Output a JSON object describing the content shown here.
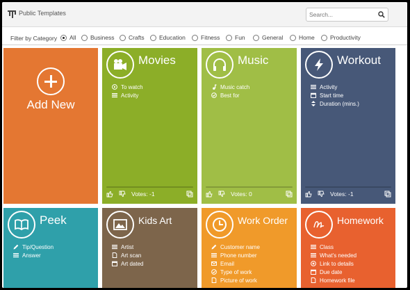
{
  "app": {
    "title": "Public Templates"
  },
  "search": {
    "placeholder": "Search..."
  },
  "filter": {
    "label": "Filter by Category",
    "options": [
      "All",
      "Business",
      "Crafts",
      "Education",
      "Fitness",
      "Fun",
      "General",
      "Home",
      "Productivity"
    ],
    "selected": "All"
  },
  "add_tile": {
    "label": "Add New",
    "color": "#e47732"
  },
  "tiles": [
    {
      "title": "Movies",
      "color": "#8cae28",
      "icon": "movie-camera-icon",
      "fields": [
        {
          "icon": "play-circle-icon",
          "label": "To watch"
        },
        {
          "icon": "list-icon",
          "label": "Activity"
        }
      ],
      "votes": "Votes: -1"
    },
    {
      "title": "Music",
      "color": "#a0be46",
      "icon": "headphones-icon",
      "fields": [
        {
          "icon": "music-note-icon",
          "label": "Music catch"
        },
        {
          "icon": "check-circle-icon",
          "label": "Best for"
        }
      ],
      "votes": "Votes: 0"
    },
    {
      "title": "Workout",
      "color": "#475878",
      "icon": "lightning-icon",
      "fields": [
        {
          "icon": "list-icon",
          "label": "Activity"
        },
        {
          "icon": "calendar-icon",
          "label": "Start time"
        },
        {
          "icon": "sort-icon",
          "label": "Duration (mins.)"
        }
      ],
      "votes": "Votes: -1"
    },
    {
      "title": "Peek",
      "color": "#2fa0aa",
      "icon": "open-book-icon",
      "fields": [
        {
          "icon": "pencil-icon",
          "label": "Tip/Question"
        },
        {
          "icon": "list-icon",
          "label": "Answer"
        }
      ],
      "votes": ""
    },
    {
      "title": "Kids Art",
      "color": "#7d654b",
      "icon": "picture-icon",
      "fields": [
        {
          "icon": "list-icon",
          "label": "Artist"
        },
        {
          "icon": "document-icon",
          "label": "Art scan"
        },
        {
          "icon": "calendar-icon",
          "label": "Art dated"
        }
      ],
      "votes": ""
    },
    {
      "title": "Work Order",
      "color": "#f09a2a",
      "icon": "clock-icon",
      "fields": [
        {
          "icon": "pencil-icon",
          "label": "Customer name"
        },
        {
          "icon": "list-icon",
          "label": "Phone number"
        },
        {
          "icon": "envelope-icon",
          "label": "Email"
        },
        {
          "icon": "check-circle-icon",
          "label": "Type of work"
        },
        {
          "icon": "document-icon",
          "label": "Picture of work"
        }
      ],
      "votes": ""
    },
    {
      "title": "Homework",
      "color": "#e8612f",
      "icon": "note-icon",
      "fields": [
        {
          "icon": "list-icon",
          "label": "Class"
        },
        {
          "icon": "list-icon",
          "label": "What's needed"
        },
        {
          "icon": "link-icon",
          "label": "Link to details"
        },
        {
          "icon": "calendar-icon",
          "label": "Due date"
        },
        {
          "icon": "document-icon",
          "label": "Homework file"
        }
      ],
      "votes": ""
    }
  ]
}
